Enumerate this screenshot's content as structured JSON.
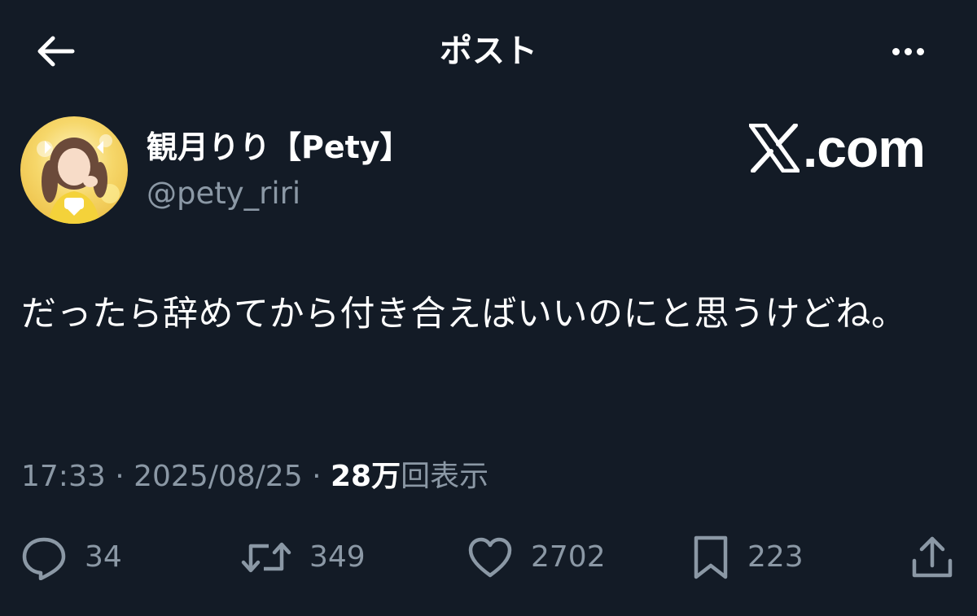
{
  "header": {
    "title": "ポスト",
    "back_icon": "arrow-left-icon",
    "more_icon": "more-horizontal-icon"
  },
  "author": {
    "display_name": "観月りり【Pety】",
    "handle": "@pety_riri",
    "avatar_icon": "avatar-photo"
  },
  "watermark": {
    "text": ".com",
    "logo_icon": "x-logo-icon"
  },
  "tweet": {
    "text": "だったら辞めてから付き合えばいいのにと思うけどね。"
  },
  "meta": {
    "time": "17:33",
    "separator": "·",
    "date": "2025/08/25",
    "views_count": "28万",
    "views_label": "回表示"
  },
  "actions": {
    "reply": {
      "icon": "reply-icon",
      "count": "34"
    },
    "repost": {
      "icon": "repost-icon",
      "count": "349"
    },
    "like": {
      "icon": "heart-icon",
      "count": "2702"
    },
    "bookmark": {
      "icon": "bookmark-icon",
      "count": "223"
    },
    "share": {
      "icon": "share-icon"
    }
  },
  "colors": {
    "background": "#131b26",
    "primary_text": "#ffffff",
    "secondary_text": "#8b98a5"
  }
}
